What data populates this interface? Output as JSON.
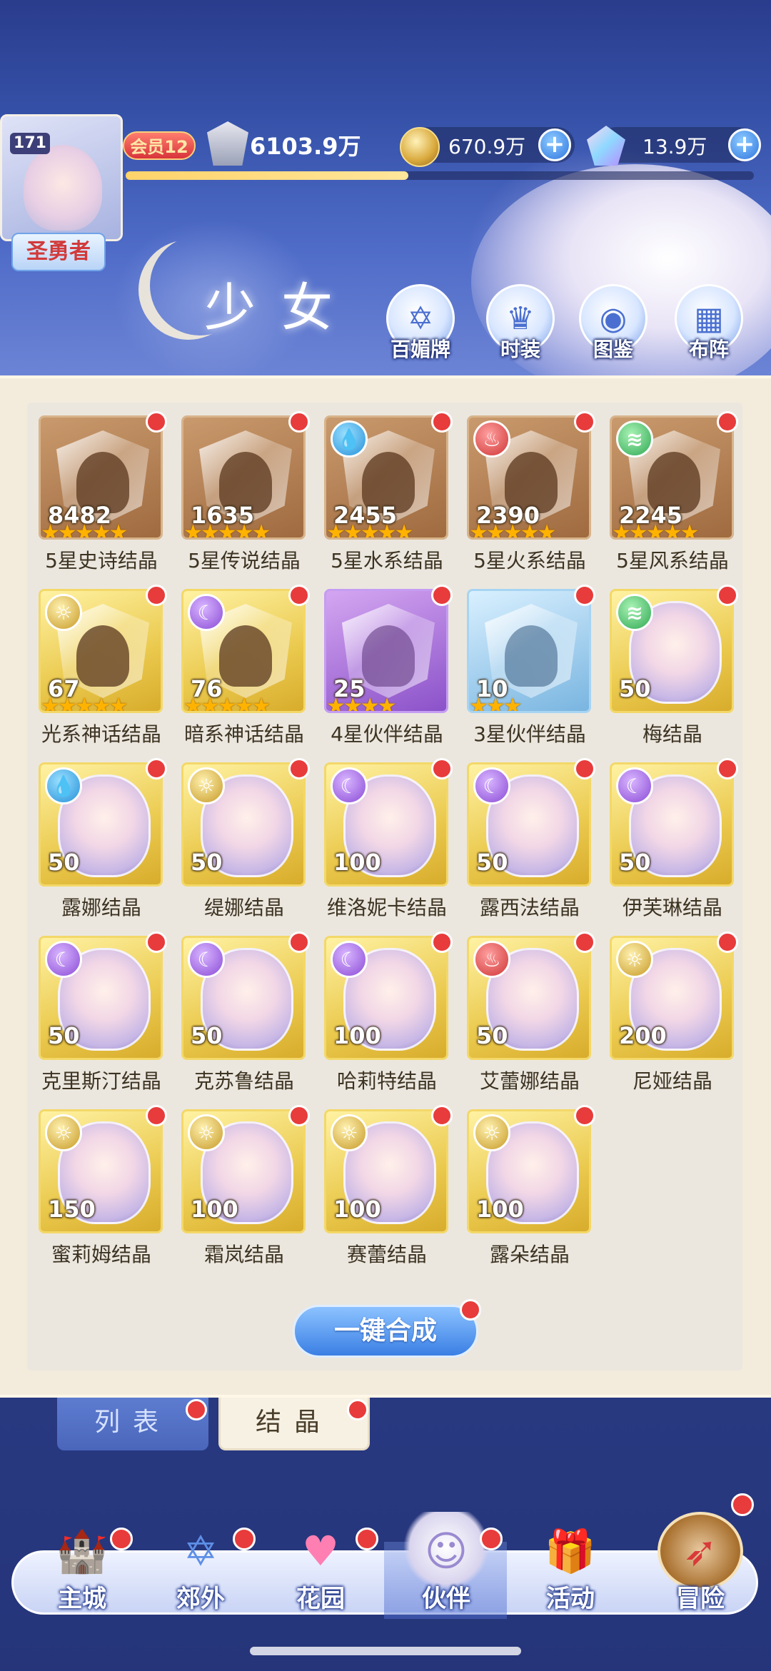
{
  "header": {
    "level": "171",
    "title": "圣勇者",
    "vip": "会员12",
    "power": "6103.9万",
    "gold": "670.9万",
    "gems": "13.9万",
    "xp_progress": 0.45
  },
  "page_heading": "少女",
  "top_buttons": [
    {
      "label": "百媚牌",
      "icon": "card-icon"
    },
    {
      "label": "时装",
      "icon": "costume-icon"
    },
    {
      "label": "图鉴",
      "icon": "book-icon"
    },
    {
      "label": "布阵",
      "icon": "formation-icon"
    }
  ],
  "crystals": [
    {
      "name": "5星史诗结晶",
      "count": "8482",
      "stars": "★★★★★",
      "style": "brown",
      "element": ""
    },
    {
      "name": "5星传说结晶",
      "count": "1635",
      "stars": "★★★★★",
      "style": "brown",
      "element": ""
    },
    {
      "name": "5星水系结晶",
      "count": "2455",
      "stars": "★★★★★",
      "style": "brown",
      "element": "water"
    },
    {
      "name": "5星火系结晶",
      "count": "2390",
      "stars": "★★★★★",
      "style": "brown",
      "element": "fire"
    },
    {
      "name": "5星风系结晶",
      "count": "2245",
      "stars": "★★★★★",
      "style": "brown",
      "element": "wind"
    },
    {
      "name": "光系神话结晶",
      "count": "67",
      "stars": "★★★★★",
      "style": "gold-crystal",
      "element": "light"
    },
    {
      "name": "暗系神话结晶",
      "count": "76",
      "stars": "★★★★★",
      "style": "gold-crystal",
      "element": "dark"
    },
    {
      "name": "4星伙伴结晶",
      "count": "25",
      "stars": "★★★★",
      "style": "purple",
      "element": ""
    },
    {
      "name": "3星伙伴结晶",
      "count": "10",
      "stars": "★★★",
      "style": "blue",
      "element": ""
    },
    {
      "name": "梅结晶",
      "count": "50",
      "stars": "",
      "style": "gold",
      "element": "wind"
    },
    {
      "name": "露娜结晶",
      "count": "50",
      "stars": "",
      "style": "gold",
      "element": "water"
    },
    {
      "name": "缇娜结晶",
      "count": "50",
      "stars": "",
      "style": "gold",
      "element": "light"
    },
    {
      "name": "维洛妮卡结晶",
      "count": "100",
      "stars": "",
      "style": "gold",
      "element": "dark"
    },
    {
      "name": "露西法结晶",
      "count": "50",
      "stars": "",
      "style": "gold",
      "element": "dark"
    },
    {
      "name": "伊芙琳结晶",
      "count": "50",
      "stars": "",
      "style": "gold",
      "element": "dark"
    },
    {
      "name": "克里斯汀结晶",
      "count": "50",
      "stars": "",
      "style": "gold",
      "element": "dark"
    },
    {
      "name": "克苏鲁结晶",
      "count": "50",
      "stars": "",
      "style": "gold",
      "element": "dark"
    },
    {
      "name": "哈莉特结晶",
      "count": "100",
      "stars": "",
      "style": "gold",
      "element": "dark"
    },
    {
      "name": "艾蕾娜结晶",
      "count": "50",
      "stars": "",
      "style": "gold",
      "element": "fire"
    },
    {
      "name": "尼娅结晶",
      "count": "200",
      "stars": "",
      "style": "gold",
      "element": "light"
    },
    {
      "name": "蜜莉姆结晶",
      "count": "150",
      "stars": "",
      "style": "gold",
      "element": "light"
    },
    {
      "name": "霜岚结晶",
      "count": "100",
      "stars": "",
      "style": "gold",
      "element": "light"
    },
    {
      "name": "赛蕾结晶",
      "count": "100",
      "stars": "",
      "style": "gold",
      "element": "light"
    },
    {
      "name": "露朵结晶",
      "count": "100",
      "stars": "",
      "style": "gold",
      "element": "light"
    }
  ],
  "merge_button": "一键合成",
  "sub_tabs": [
    "列表",
    "结晶"
  ],
  "nav": [
    {
      "label": "主城",
      "icon": "castle-icon"
    },
    {
      "label": "郊外",
      "icon": "portal-icon"
    },
    {
      "label": "花园",
      "icon": "heart-icon"
    },
    {
      "label": "伙伴",
      "icon": "partner-icon"
    },
    {
      "label": "活动",
      "icon": "gift-icon"
    },
    {
      "label": "冒险",
      "icon": "compass-icon"
    }
  ],
  "colors": {
    "notification": "#e83b3b",
    "accent_blue": "#3a7fe4",
    "star": "#ffb300"
  }
}
